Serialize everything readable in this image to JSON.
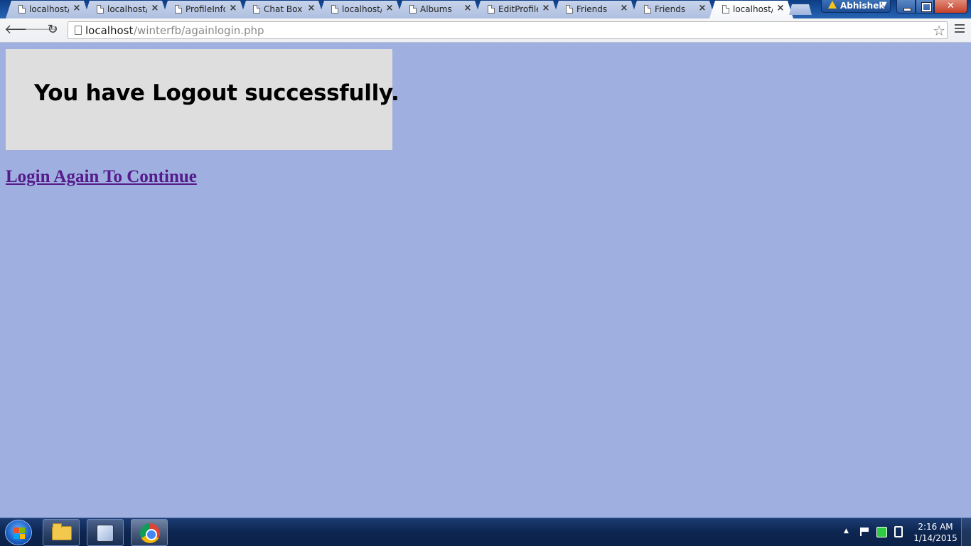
{
  "browser": {
    "tabs": [
      {
        "label": "localhost/",
        "active": false
      },
      {
        "label": "localhost/",
        "active": false
      },
      {
        "label": "ProfileInfo",
        "active": false
      },
      {
        "label": "Chat Box",
        "active": false
      },
      {
        "label": "localhost/",
        "active": false
      },
      {
        "label": "Albums",
        "active": false
      },
      {
        "label": "EditProfile",
        "active": false
      },
      {
        "label": "Friends",
        "active": false
      },
      {
        "label": "Friends",
        "active": false
      },
      {
        "label": "localhost/",
        "active": true
      }
    ],
    "tab_close_glyph": "×",
    "profile_name": "Abhishek",
    "url_host": "localhost",
    "url_path": "/winterfb/againlogin.php"
  },
  "page": {
    "logout_message": "You have Logout successfully.",
    "login_link_text": "Login Again To Continue",
    "background_color": "#9fafdf",
    "box_color": "#dedede",
    "link_color": "#551a8b"
  },
  "taskbar": {
    "clock_time": "2:16 AM",
    "clock_date": "1/14/2015"
  },
  "icons": [
    "page-icon",
    "back-arrow-icon",
    "forward-arrow-icon",
    "reload-icon",
    "star-icon",
    "menu-icon",
    "warning-icon",
    "windows-logo-icon",
    "folder-icon",
    "virtualbox-icon",
    "chrome-icon",
    "flag-icon",
    "sync-icon",
    "power-icon"
  ]
}
